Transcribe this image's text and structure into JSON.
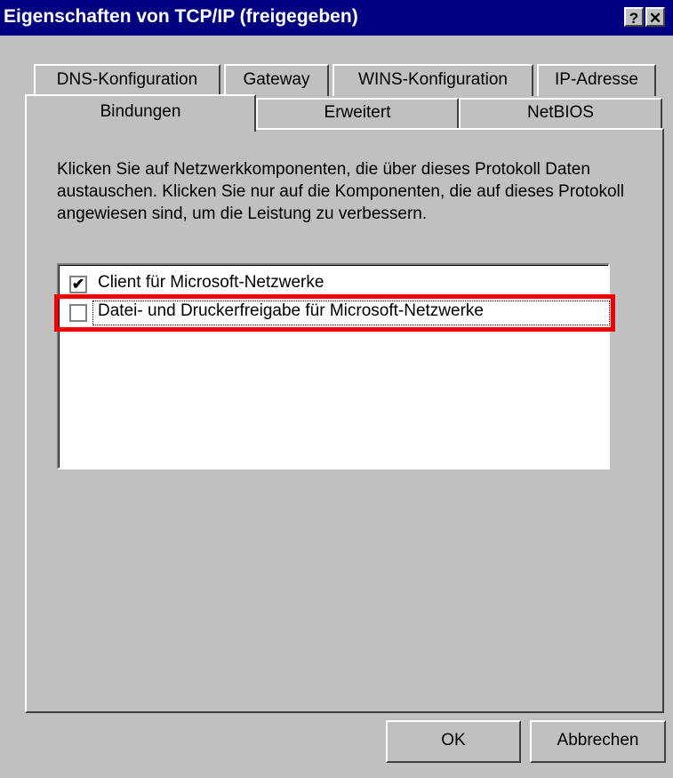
{
  "window": {
    "title": "Eigenschaften von TCP/IP (freigegeben)",
    "help_glyph": "?",
    "close_glyph": "✕"
  },
  "tabs_back_row": [
    {
      "label": "DNS-Konfiguration"
    },
    {
      "label": "Gateway"
    },
    {
      "label": "WINS-Konfiguration"
    },
    {
      "label": "IP-Adresse"
    }
  ],
  "tabs_front_row": [
    {
      "label": "Bindungen",
      "active": true
    },
    {
      "label": "Erweitert"
    },
    {
      "label": "NetBIOS"
    }
  ],
  "description": "Klicken Sie auf Netzwerkkomponenten, die über dieses Protokoll Daten austauschen. Klicken Sie nur auf die Komponenten, die auf dieses Protokoll angewiesen sind, um die Leistung zu verbessern.",
  "bindings": [
    {
      "label": "Client für Microsoft-Netzwerke",
      "checked": true,
      "mark": "✔"
    },
    {
      "label": "Datei- und Druckerfreigabe für Microsoft-Netzwerke",
      "checked": false,
      "mark": ""
    }
  ],
  "buttons": {
    "ok": "OK",
    "cancel": "Abbrechen"
  },
  "colors": {
    "titlebar": "#000080",
    "face": "#c0c0c0",
    "highlight": "#ee0000"
  }
}
